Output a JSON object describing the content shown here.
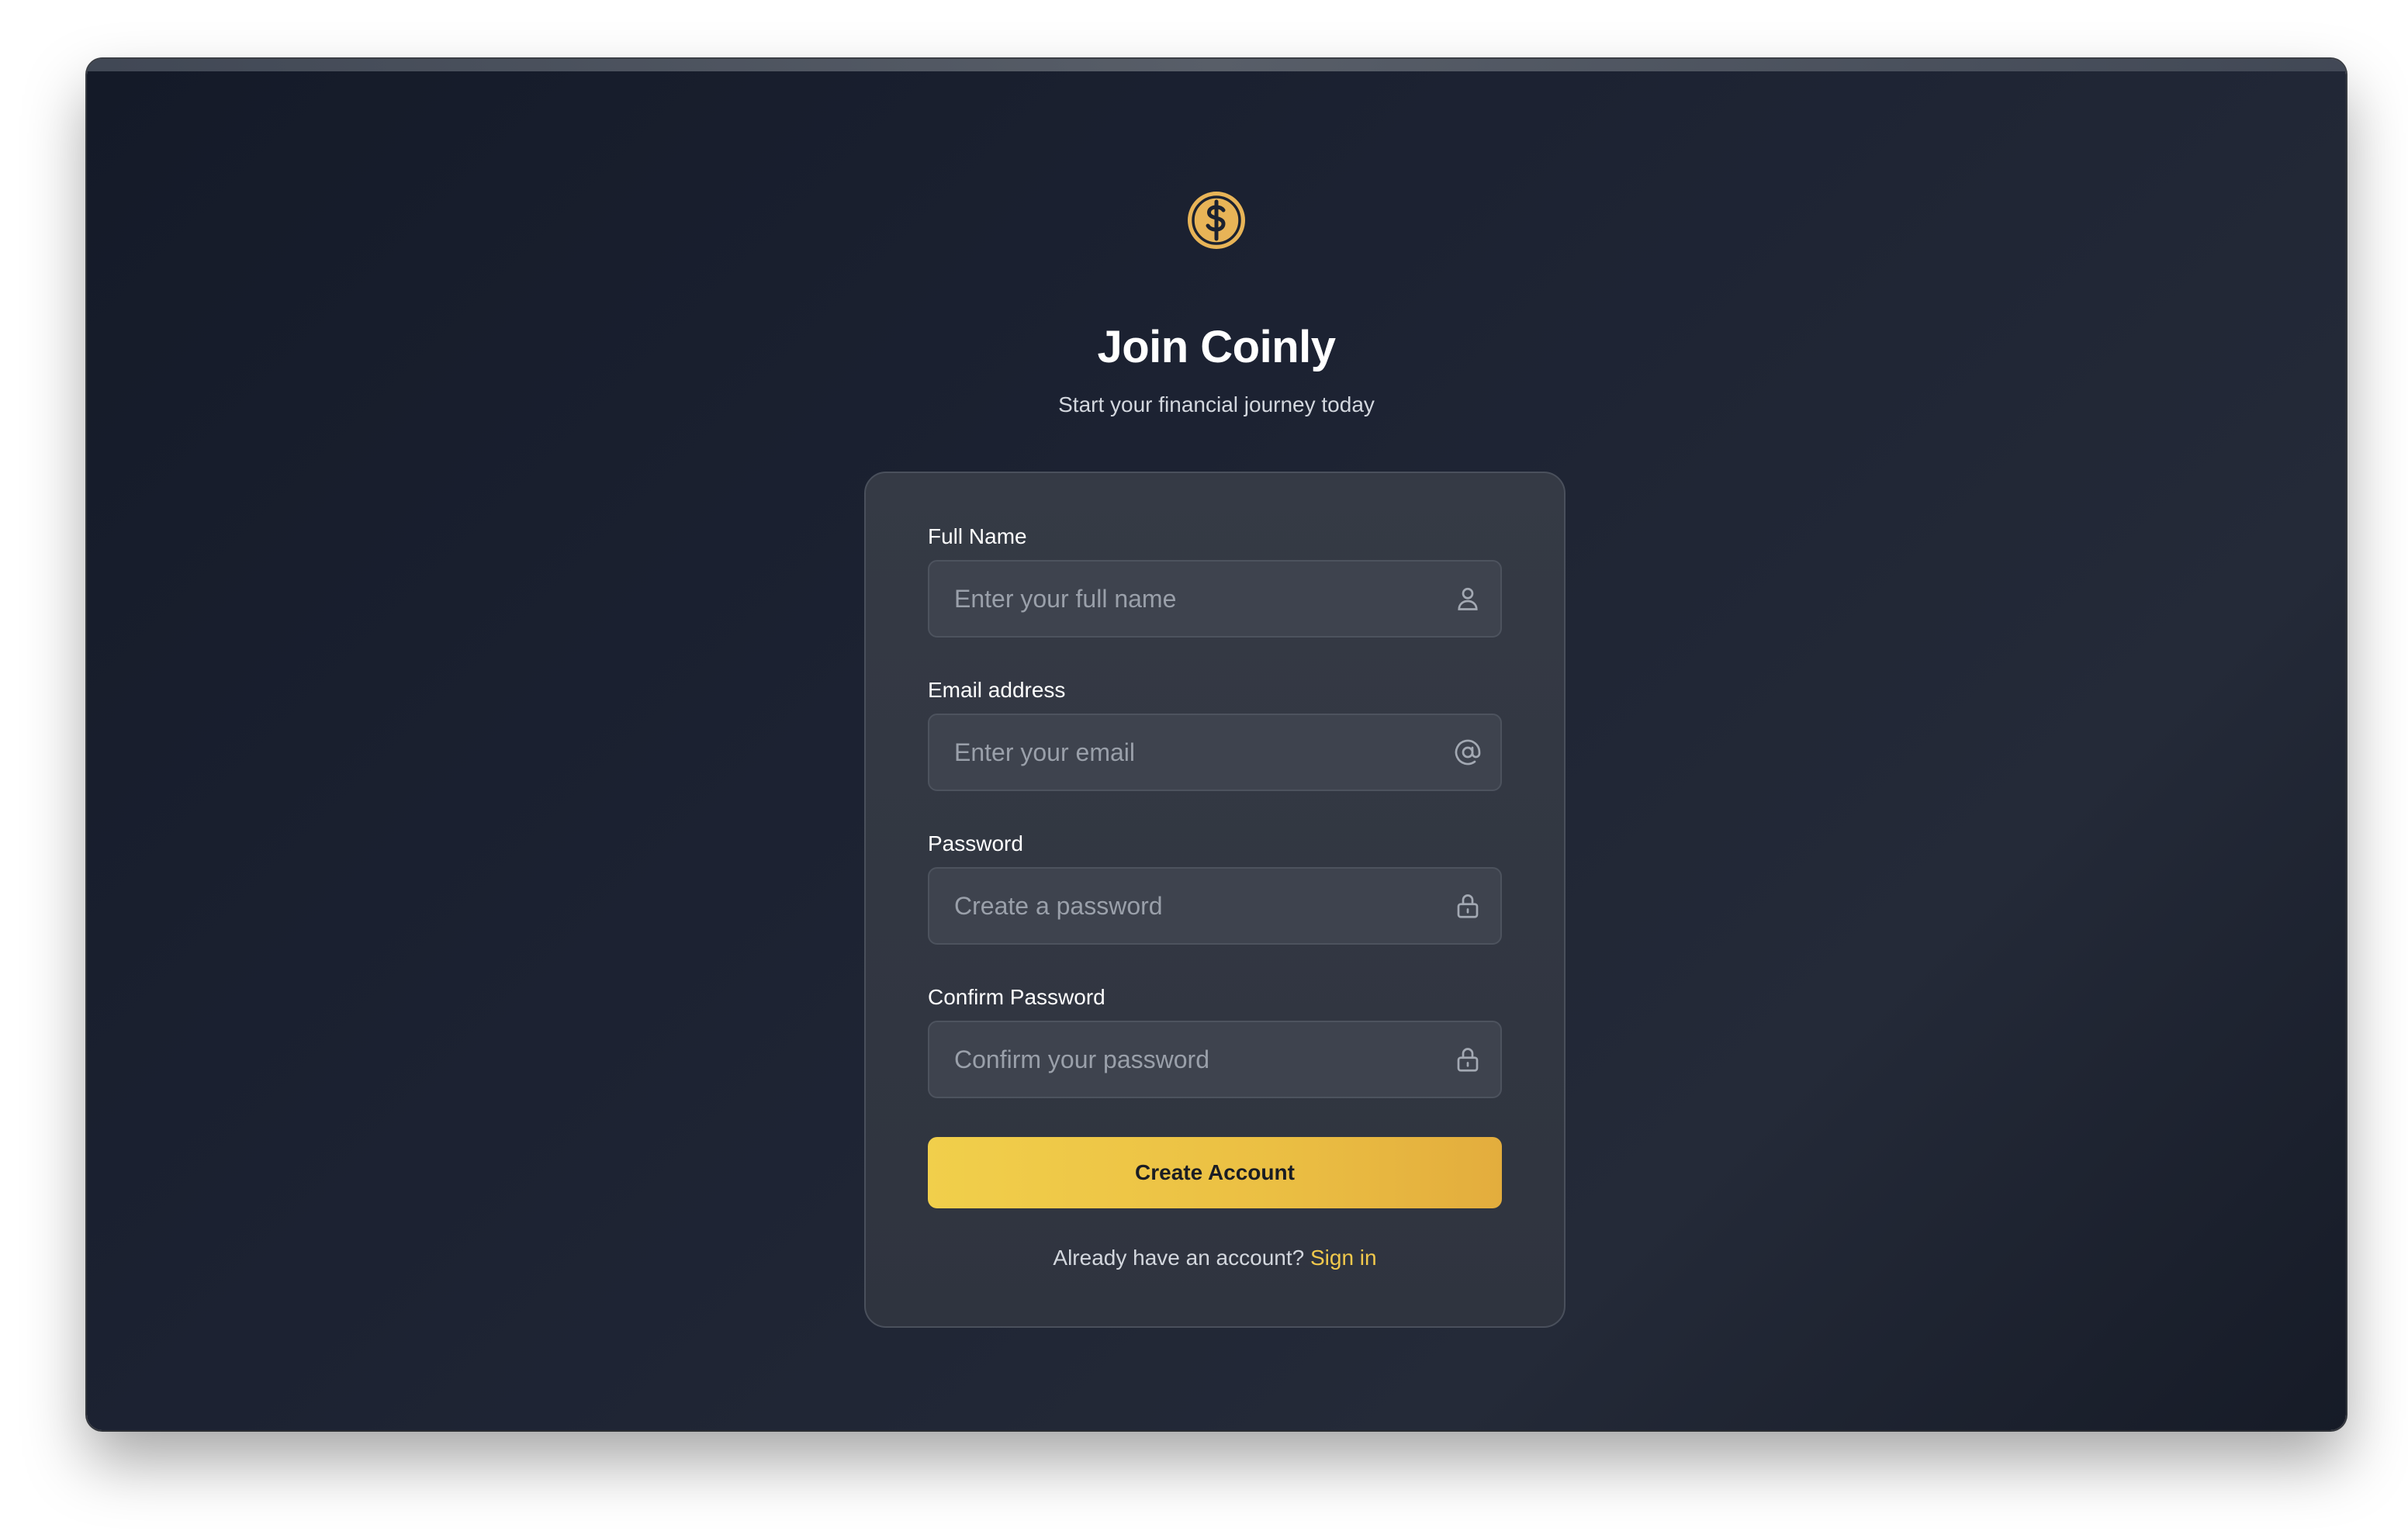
{
  "brand": {
    "title": "Join Coinly",
    "subtitle": "Start your financial journey today",
    "logo_icon": "dollar-coin-icon",
    "accent_color": "#f2c94c"
  },
  "form": {
    "fields": [
      {
        "label": "Full Name",
        "placeholder": "Enter your full name",
        "icon": "user-icon"
      },
      {
        "label": "Email address",
        "placeholder": "Enter your email",
        "icon": "at-sign-icon"
      },
      {
        "label": "Password",
        "placeholder": "Create a password",
        "icon": "lock-icon"
      },
      {
        "label": "Confirm Password",
        "placeholder": "Confirm your password",
        "icon": "lock-icon"
      }
    ],
    "submit_label": "Create Account",
    "footer_text": "Already have an account?",
    "footer_link": "Sign in"
  }
}
